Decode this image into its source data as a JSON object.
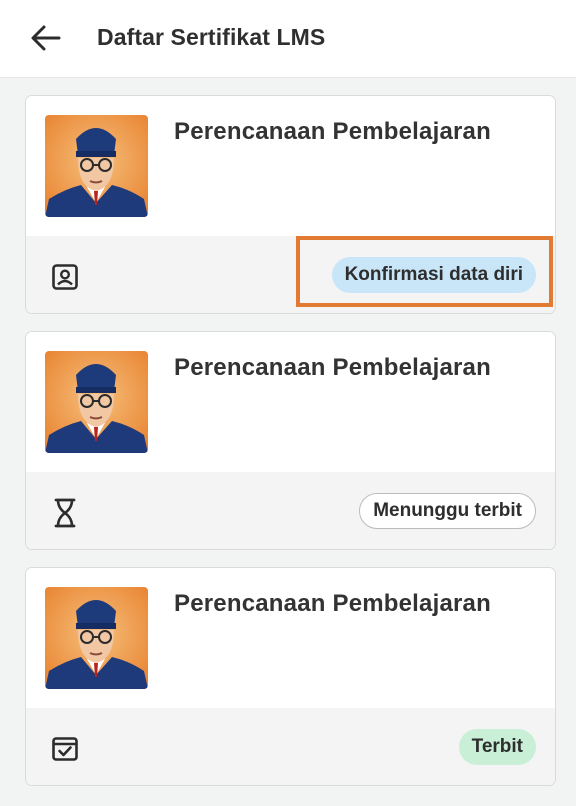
{
  "header": {
    "title": "Daftar Sertifikat LMS",
    "back_icon": "arrow-left-icon"
  },
  "certificates": [
    {
      "title": "Perencanaan Pembelajaran",
      "status_icon": "id-card-icon",
      "status_label": "Konfirmasi data diri",
      "status_color": "#c8e6f8"
    },
    {
      "title": "Perencanaan Pembelajaran",
      "status_icon": "hourglass-icon",
      "status_label": "Menunggu terbit",
      "status_color": "#ffffff"
    },
    {
      "title": "Perencanaan Pembelajaran",
      "status_icon": "check-calendar-icon",
      "status_label": "Terbit",
      "status_color": "#c9efd7"
    }
  ],
  "colors": {
    "highlight": "#e27a32",
    "background": "#f2f3f3"
  }
}
